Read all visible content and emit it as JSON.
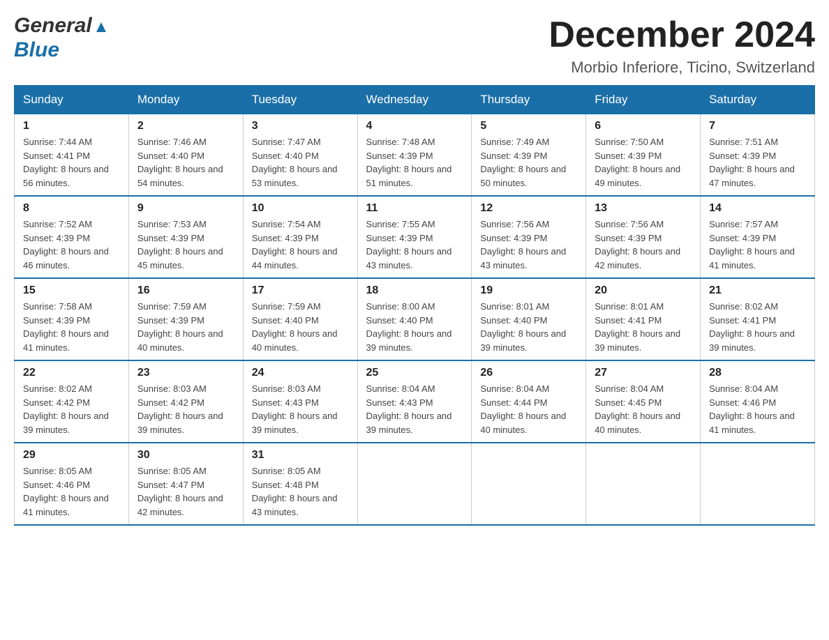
{
  "header": {
    "logo_general": "General",
    "logo_blue": "Blue",
    "month_title": "December 2024",
    "location": "Morbio Inferiore, Ticino, Switzerland"
  },
  "days_of_week": [
    "Sunday",
    "Monday",
    "Tuesday",
    "Wednesday",
    "Thursday",
    "Friday",
    "Saturday"
  ],
  "weeks": [
    [
      {
        "day": "1",
        "sunrise": "Sunrise: 7:44 AM",
        "sunset": "Sunset: 4:41 PM",
        "daylight": "Daylight: 8 hours and 56 minutes."
      },
      {
        "day": "2",
        "sunrise": "Sunrise: 7:46 AM",
        "sunset": "Sunset: 4:40 PM",
        "daylight": "Daylight: 8 hours and 54 minutes."
      },
      {
        "day": "3",
        "sunrise": "Sunrise: 7:47 AM",
        "sunset": "Sunset: 4:40 PM",
        "daylight": "Daylight: 8 hours and 53 minutes."
      },
      {
        "day": "4",
        "sunrise": "Sunrise: 7:48 AM",
        "sunset": "Sunset: 4:39 PM",
        "daylight": "Daylight: 8 hours and 51 minutes."
      },
      {
        "day": "5",
        "sunrise": "Sunrise: 7:49 AM",
        "sunset": "Sunset: 4:39 PM",
        "daylight": "Daylight: 8 hours and 50 minutes."
      },
      {
        "day": "6",
        "sunrise": "Sunrise: 7:50 AM",
        "sunset": "Sunset: 4:39 PM",
        "daylight": "Daylight: 8 hours and 49 minutes."
      },
      {
        "day": "7",
        "sunrise": "Sunrise: 7:51 AM",
        "sunset": "Sunset: 4:39 PM",
        "daylight": "Daylight: 8 hours and 47 minutes."
      }
    ],
    [
      {
        "day": "8",
        "sunrise": "Sunrise: 7:52 AM",
        "sunset": "Sunset: 4:39 PM",
        "daylight": "Daylight: 8 hours and 46 minutes."
      },
      {
        "day": "9",
        "sunrise": "Sunrise: 7:53 AM",
        "sunset": "Sunset: 4:39 PM",
        "daylight": "Daylight: 8 hours and 45 minutes."
      },
      {
        "day": "10",
        "sunrise": "Sunrise: 7:54 AM",
        "sunset": "Sunset: 4:39 PM",
        "daylight": "Daylight: 8 hours and 44 minutes."
      },
      {
        "day": "11",
        "sunrise": "Sunrise: 7:55 AM",
        "sunset": "Sunset: 4:39 PM",
        "daylight": "Daylight: 8 hours and 43 minutes."
      },
      {
        "day": "12",
        "sunrise": "Sunrise: 7:56 AM",
        "sunset": "Sunset: 4:39 PM",
        "daylight": "Daylight: 8 hours and 43 minutes."
      },
      {
        "day": "13",
        "sunrise": "Sunrise: 7:56 AM",
        "sunset": "Sunset: 4:39 PM",
        "daylight": "Daylight: 8 hours and 42 minutes."
      },
      {
        "day": "14",
        "sunrise": "Sunrise: 7:57 AM",
        "sunset": "Sunset: 4:39 PM",
        "daylight": "Daylight: 8 hours and 41 minutes."
      }
    ],
    [
      {
        "day": "15",
        "sunrise": "Sunrise: 7:58 AM",
        "sunset": "Sunset: 4:39 PM",
        "daylight": "Daylight: 8 hours and 41 minutes."
      },
      {
        "day": "16",
        "sunrise": "Sunrise: 7:59 AM",
        "sunset": "Sunset: 4:39 PM",
        "daylight": "Daylight: 8 hours and 40 minutes."
      },
      {
        "day": "17",
        "sunrise": "Sunrise: 7:59 AM",
        "sunset": "Sunset: 4:40 PM",
        "daylight": "Daylight: 8 hours and 40 minutes."
      },
      {
        "day": "18",
        "sunrise": "Sunrise: 8:00 AM",
        "sunset": "Sunset: 4:40 PM",
        "daylight": "Daylight: 8 hours and 39 minutes."
      },
      {
        "day": "19",
        "sunrise": "Sunrise: 8:01 AM",
        "sunset": "Sunset: 4:40 PM",
        "daylight": "Daylight: 8 hours and 39 minutes."
      },
      {
        "day": "20",
        "sunrise": "Sunrise: 8:01 AM",
        "sunset": "Sunset: 4:41 PM",
        "daylight": "Daylight: 8 hours and 39 minutes."
      },
      {
        "day": "21",
        "sunrise": "Sunrise: 8:02 AM",
        "sunset": "Sunset: 4:41 PM",
        "daylight": "Daylight: 8 hours and 39 minutes."
      }
    ],
    [
      {
        "day": "22",
        "sunrise": "Sunrise: 8:02 AM",
        "sunset": "Sunset: 4:42 PM",
        "daylight": "Daylight: 8 hours and 39 minutes."
      },
      {
        "day": "23",
        "sunrise": "Sunrise: 8:03 AM",
        "sunset": "Sunset: 4:42 PM",
        "daylight": "Daylight: 8 hours and 39 minutes."
      },
      {
        "day": "24",
        "sunrise": "Sunrise: 8:03 AM",
        "sunset": "Sunset: 4:43 PM",
        "daylight": "Daylight: 8 hours and 39 minutes."
      },
      {
        "day": "25",
        "sunrise": "Sunrise: 8:04 AM",
        "sunset": "Sunset: 4:43 PM",
        "daylight": "Daylight: 8 hours and 39 minutes."
      },
      {
        "day": "26",
        "sunrise": "Sunrise: 8:04 AM",
        "sunset": "Sunset: 4:44 PM",
        "daylight": "Daylight: 8 hours and 40 minutes."
      },
      {
        "day": "27",
        "sunrise": "Sunrise: 8:04 AM",
        "sunset": "Sunset: 4:45 PM",
        "daylight": "Daylight: 8 hours and 40 minutes."
      },
      {
        "day": "28",
        "sunrise": "Sunrise: 8:04 AM",
        "sunset": "Sunset: 4:46 PM",
        "daylight": "Daylight: 8 hours and 41 minutes."
      }
    ],
    [
      {
        "day": "29",
        "sunrise": "Sunrise: 8:05 AM",
        "sunset": "Sunset: 4:46 PM",
        "daylight": "Daylight: 8 hours and 41 minutes."
      },
      {
        "day": "30",
        "sunrise": "Sunrise: 8:05 AM",
        "sunset": "Sunset: 4:47 PM",
        "daylight": "Daylight: 8 hours and 42 minutes."
      },
      {
        "day": "31",
        "sunrise": "Sunrise: 8:05 AM",
        "sunset": "Sunset: 4:48 PM",
        "daylight": "Daylight: 8 hours and 43 minutes."
      },
      null,
      null,
      null,
      null
    ]
  ]
}
